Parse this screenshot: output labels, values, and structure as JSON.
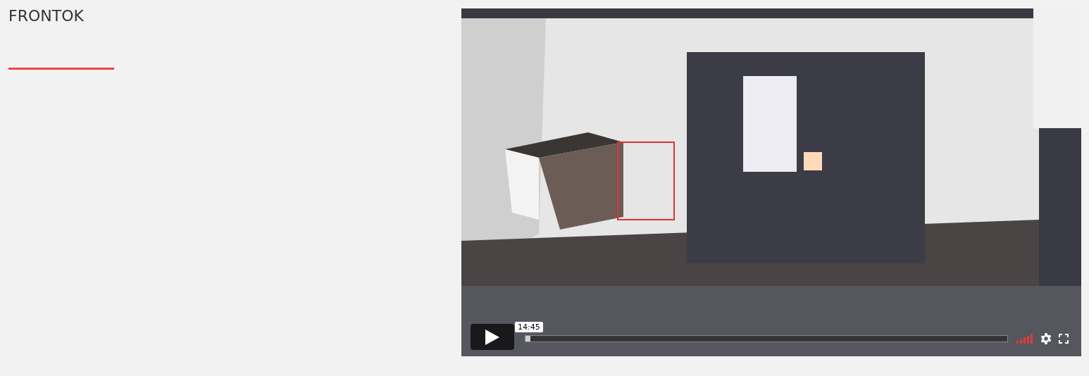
{
  "heading": "FRONTOK",
  "video": {
    "time_tooltip": "14:45",
    "progress": {
      "level": 0.01
    }
  }
}
